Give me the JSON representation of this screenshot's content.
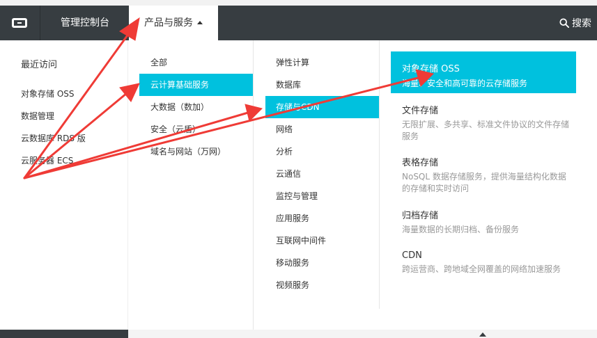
{
  "nav": {
    "console_label": "管理控制台",
    "products_label": "产品与服务",
    "search_label": "搜索"
  },
  "col1": {
    "title": "最近访问",
    "items": [
      "对象存储 OSS",
      "数据管理",
      "云数据库 RDS 版",
      "云服务器 ECS"
    ]
  },
  "col2": {
    "items": [
      "全部",
      "云计算基础服务",
      "大数据（数加）",
      "安全（云盾）",
      "域名与网站（万网）"
    ],
    "active_index": 1
  },
  "col3": {
    "items": [
      "弹性计算",
      "数据库",
      "存储与CDN",
      "网络",
      "分析",
      "云通信",
      "监控与管理",
      "应用服务",
      "互联网中间件",
      "移动服务",
      "视频服务"
    ],
    "active_index": 2
  },
  "col4": {
    "items": [
      {
        "title": "对象存储 OSS",
        "desc": "海量、安全和高可靠的云存储服务"
      },
      {
        "title": "文件存储",
        "desc": "无限扩展、多共享、标准文件协议的文件存储服务"
      },
      {
        "title": "表格存储",
        "desc": "NoSQL 数据存储服务，提供海量结构化数据的存储和实时访问"
      },
      {
        "title": "归档存储",
        "desc": "海量数据的长期归档、备份服务"
      },
      {
        "title": "CDN",
        "desc": "跨运营商、跨地域全网覆盖的网络加速服务"
      }
    ],
    "active_index": 0
  },
  "colors": {
    "nav_bg": "#373d41",
    "accent": "#00c1de",
    "annotation_arrow": "#ef3b36"
  }
}
